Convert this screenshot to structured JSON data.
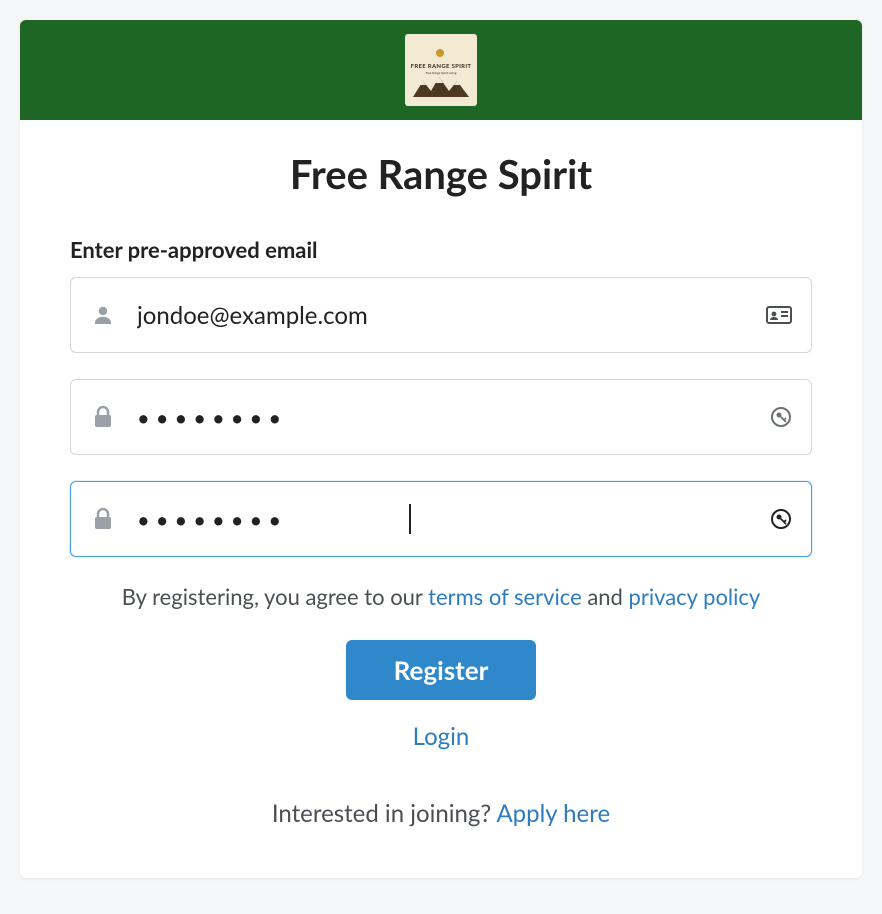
{
  "brand": {
    "logo_text": "FREE RANGE SPIRIT",
    "logo_subtext": "Free Range Spirit Living"
  },
  "title": "Free Range Spirit",
  "form": {
    "email_label": "Enter pre-approved email",
    "email_value": "jondoe@example.com",
    "password_value": "••••••••",
    "confirm_value": "••••••••"
  },
  "legal": {
    "prefix": "By registering, you agree to our ",
    "tos": "terms of service",
    "middle": " and ",
    "privacy": "privacy policy"
  },
  "actions": {
    "register": "Register",
    "login": "Login"
  },
  "apply": {
    "prefix": "Interested in joining? ",
    "link": "Apply here"
  }
}
